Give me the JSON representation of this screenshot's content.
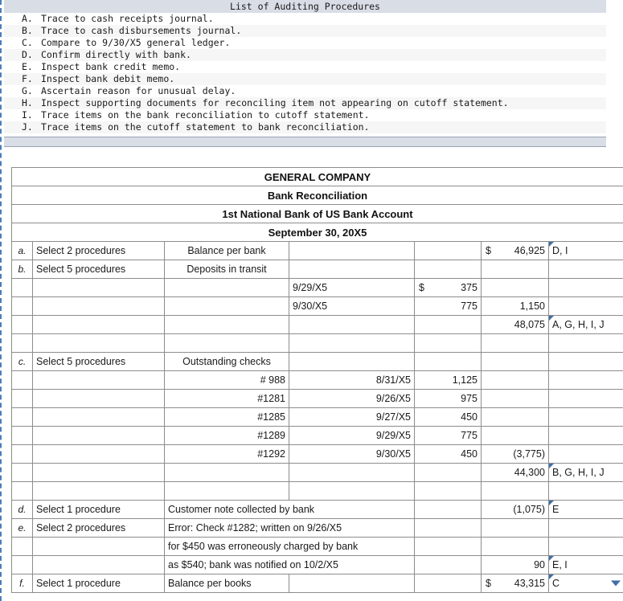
{
  "procedures_panel": {
    "title": "List of Auditing Procedures",
    "items": [
      {
        "letter": "A.",
        "text": "Trace to cash receipts journal."
      },
      {
        "letter": "B.",
        "text": "Trace to cash disbursements journal."
      },
      {
        "letter": "C.",
        "text": "Compare to 9/30/X5 general ledger."
      },
      {
        "letter": "D.",
        "text": "Confirm directly with bank."
      },
      {
        "letter": "E.",
        "text": "Inspect bank credit memo."
      },
      {
        "letter": "F.",
        "text": "Inspect bank debit memo."
      },
      {
        "letter": "G.",
        "text": "Ascertain reason for unusual delay."
      },
      {
        "letter": "H.",
        "text": "Inspect supporting documents for reconciling item not appearing on cutoff statement."
      },
      {
        "letter": "I.",
        "text": "Trace items on the bank reconciliation to cutoff statement."
      },
      {
        "letter": "J.",
        "text": "Trace items on the cutoff statement to bank reconciliation."
      }
    ]
  },
  "worksheet": {
    "headers": [
      "GENERAL COMPANY",
      "Bank Reconciliation",
      "1st National Bank of US Bank Account",
      "September 30, 20X5"
    ],
    "rows": [
      {
        "idx": "a.",
        "instruction": "Select 2 procedures",
        "desc": "Balance per bank",
        "desc_align": "ctr",
        "sub": "",
        "date": "",
        "amt1": "",
        "amt2_dollar": "$",
        "amt2": "46,925",
        "answer": "D, I"
      },
      {
        "idx": "b.",
        "instruction": "Select 5 procedures",
        "desc": "Deposits in transit",
        "desc_align": "ctr",
        "sub": "",
        "date": "",
        "amt1": "",
        "amt2": "",
        "answer": null
      },
      {
        "idx": "",
        "instruction": "",
        "desc": "",
        "sub": "9/29/X5",
        "sub_align": "left",
        "amt1_dollar": "$",
        "amt1": "375",
        "amt2": "",
        "answer": null
      },
      {
        "idx": "",
        "instruction": "",
        "desc": "",
        "sub": "9/30/X5",
        "sub_align": "left",
        "amt1": "775",
        "amt1_rule": true,
        "amt2": "1,150",
        "answer": null
      },
      {
        "idx": "",
        "instruction": "",
        "desc": "",
        "sub": "",
        "amt1": "",
        "amt2": "48,075",
        "answer": "A, G, H, I, J"
      },
      {
        "idx": "",
        "instruction": "",
        "desc": "",
        "sub": "",
        "amt1": "",
        "amt2": "",
        "answer": null
      },
      {
        "idx": "c.",
        "instruction": "Select 5 procedures",
        "desc": "Outstanding checks",
        "desc_align": "ctr",
        "sub": "",
        "amt1": "",
        "amt2": "",
        "answer": null
      },
      {
        "idx": "",
        "instruction": "",
        "desc": "# 988",
        "desc_align": "right",
        "sub": "8/31/X5",
        "sub_align": "right",
        "amt1": "1,125",
        "amt2": "",
        "answer": null
      },
      {
        "idx": "",
        "instruction": "",
        "desc": "#1281",
        "desc_align": "right",
        "sub": "9/26/X5",
        "sub_align": "right",
        "amt1": "975",
        "amt2": "",
        "answer": null
      },
      {
        "idx": "",
        "instruction": "",
        "desc": "#1285",
        "desc_align": "right",
        "sub": "9/27/X5",
        "sub_align": "right",
        "amt1": "450",
        "amt2": "",
        "answer": null
      },
      {
        "idx": "",
        "instruction": "",
        "desc": "#1289",
        "desc_align": "right",
        "sub": "9/29/X5",
        "sub_align": "right",
        "amt1": "775",
        "amt2": "",
        "answer": null
      },
      {
        "idx": "",
        "instruction": "",
        "desc": "#1292",
        "desc_align": "right",
        "sub": "9/30/X5",
        "sub_align": "right",
        "amt1": "450",
        "amt1_rule": true,
        "amt2": "(3,775)",
        "answer": null
      },
      {
        "idx": "",
        "instruction": "",
        "desc": "",
        "sub": "",
        "amt1": "",
        "amt2": "44,300",
        "answer": "B, G, H, I, J"
      },
      {
        "idx": "",
        "instruction": "",
        "desc": "",
        "sub": "",
        "amt1": "",
        "amt2": "",
        "answer": null
      },
      {
        "idx": "d.",
        "instruction": "Select 1 procedure",
        "desc": "Customer note collected by bank",
        "desc_align": "left",
        "desc_span": 2,
        "sub": "",
        "amt1": "",
        "amt2": "(1,075)",
        "answer": "E"
      },
      {
        "idx": "e.",
        "instruction": "Select 2 procedures",
        "desc": "Error: Check #1282; written on 9/26/X5",
        "desc_align": "left",
        "desc_span": 2,
        "sub": "",
        "amt1": "",
        "amt2": "",
        "answer": null
      },
      {
        "idx": "",
        "instruction": "",
        "desc": "for $450 was erroneously charged by bank",
        "desc_align": "left",
        "desc_span": 2,
        "sub": "",
        "amt1": "",
        "amt2": "",
        "answer": null
      },
      {
        "idx": "",
        "instruction": "",
        "desc": "as $540; bank was notified on 10/2/X5",
        "desc_align": "left",
        "desc_span": 2,
        "sub": "",
        "amt1": "",
        "amt2": "90",
        "answer": "E, I"
      },
      {
        "idx": "f.",
        "instruction": "Select 1 procedure",
        "desc": "Balance per books",
        "desc_align": "left",
        "sub": "",
        "amt1": "",
        "amt2_dollar": "$",
        "amt2": "43,315",
        "amt2_rule": true,
        "answer": "C",
        "answer_dropdown": true
      }
    ]
  },
  "colors": {
    "header_blue": "#74abe3",
    "answer_border": "#4a7ebb",
    "panel_header": "#d9dde6",
    "alt_row": "#f6f6f6"
  }
}
